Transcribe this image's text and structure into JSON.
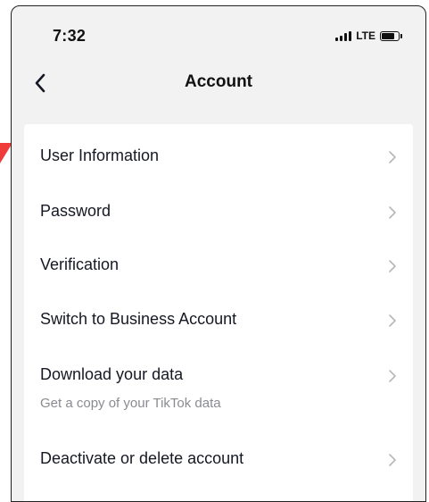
{
  "status_bar": {
    "time": "7:32",
    "network": "LTE",
    "signal_icon": "signal-bars-icon",
    "battery_icon": "battery-icon"
  },
  "header": {
    "title": "Account",
    "back_icon": "chevron-left-icon"
  },
  "menu": {
    "items": [
      {
        "label": "User Information"
      },
      {
        "label": "Password"
      },
      {
        "label": "Verification"
      },
      {
        "label": "Switch to Business Account"
      },
      {
        "label": "Download your data",
        "subtitle": "Get a copy of your TikTok data"
      },
      {
        "label": "Deactivate or delete account"
      }
    ],
    "chevron_icon": "chevron-right-icon"
  },
  "colors": {
    "annotation_marker": "#ef3b3a",
    "background": "#f2f2f2",
    "card": "#ffffff",
    "text_primary": "#161823",
    "text_secondary": "#8a8b91",
    "chevron": "#b7b7bb"
  }
}
